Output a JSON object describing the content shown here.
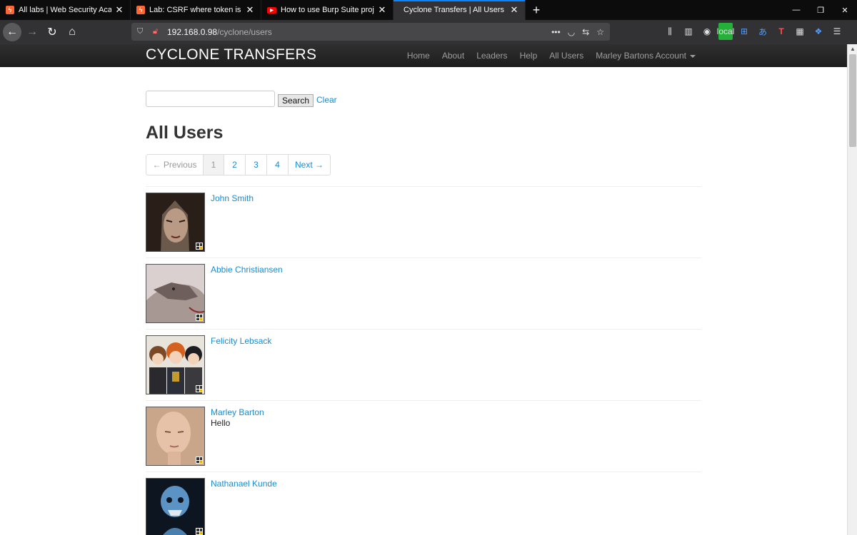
{
  "browser": {
    "tabs": [
      {
        "title": "All labs | Web Security Academy",
        "favicon": "burp-icon"
      },
      {
        "title": "Lab: CSRF where token is not tied to user session",
        "favicon": "burp-icon"
      },
      {
        "title": "How to use Burp Suite projects",
        "favicon": "youtube-icon"
      },
      {
        "title": "Cyclone Transfers | All Users",
        "favicon": "none",
        "active": true
      }
    ],
    "url_host": "192.168.0.98",
    "url_path": "/cyclone/users",
    "local_badge": "local",
    "accent": "#0a84ff"
  },
  "site": {
    "brand": "CYCLONE TRANSFERS",
    "nav": [
      "Home",
      "About",
      "Leaders",
      "Help",
      "All Users"
    ],
    "account_menu": "Marley Bartons Account"
  },
  "search": {
    "value": "",
    "button_label": "Search",
    "clear_label": "Clear"
  },
  "page_title": "All Users",
  "pagination": {
    "previous": "← Previous",
    "pages": [
      "1",
      "2",
      "3",
      "4"
    ],
    "current": "1",
    "next": "Next →"
  },
  "users": [
    {
      "name": "John Smith",
      "bio": ""
    },
    {
      "name": "Abbie Christiansen",
      "bio": ""
    },
    {
      "name": "Felicity Lebsack",
      "bio": ""
    },
    {
      "name": "Marley Barton",
      "bio": "Hello"
    },
    {
      "name": "Nathanael Kunde",
      "bio": ""
    }
  ],
  "colors": {
    "link": "#1a8ccf",
    "header_bg": "#222222"
  }
}
